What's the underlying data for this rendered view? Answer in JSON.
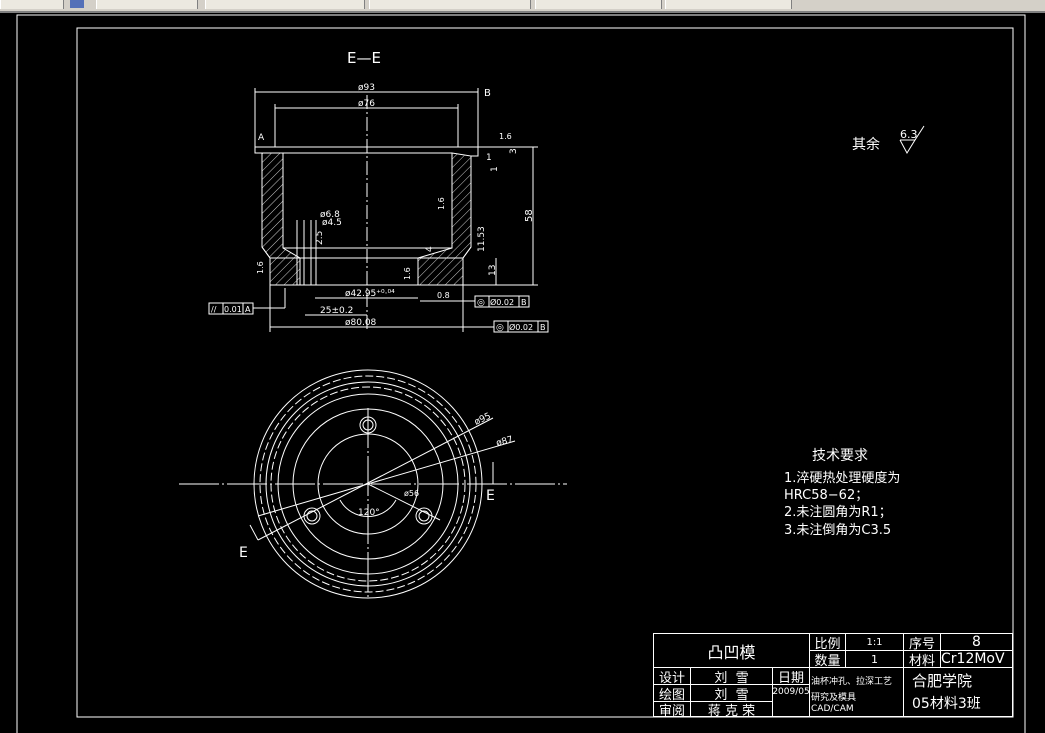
{
  "drawing": {
    "section_label": "E—E",
    "dims": {
      "d93": "ø93",
      "d76": "ø76",
      "d68": "ø6.8",
      "d45": "ø4.5",
      "h25": "2.5",
      "d4295": "ø42.95⁺⁰·⁰⁴",
      "l25": "25±0.2",
      "d8008": "ø80.08",
      "h58": "58",
      "h13": "13",
      "h1153": "11.53",
      "h4": "4",
      "h3": "3",
      "h1a": "1",
      "h1b": "1",
      "r16": "1.6",
      "r08": "0.8",
      "datum_b": "B",
      "datum_a": "A",
      "rough_a": "1.6",
      "rough_b": "1.6",
      "rough_c": "1.6"
    },
    "tolerances": [
      {
        "symbol": "//",
        "value": "0.01",
        "datum": "A"
      },
      {
        "symbol": "◎",
        "value": "Ø0.02",
        "datum": "B"
      },
      {
        "symbol": "◎",
        "value": "Ø0.02",
        "datum": "B"
      }
    ],
    "plan": {
      "d95": "ø95",
      "d87": "ø87",
      "r56": "ø56",
      "angle": "120°",
      "cut_e1": "E",
      "cut_e2": "E"
    },
    "surface_note": {
      "label": "其余",
      "value": "6.3"
    },
    "tech_requirements": {
      "title": "技术要求",
      "lines": [
        "1.淬硬热处理硬度为",
        "HRC58−62；",
        "2.未注圆角为R1；",
        "3.未注倒角为C3.5"
      ]
    }
  },
  "title_block": {
    "part_name": "凸凹模",
    "scale_label": "比例",
    "scale_value": "1:1",
    "qty_label": "数量",
    "qty_value": "1",
    "seq_label": "序号",
    "seq_value": "8",
    "material_label": "材料",
    "material_value": "Cr12MoV",
    "design_label": "设计",
    "design_name": "刘  雪",
    "draw_label": "绘图",
    "draw_name": "刘  雪",
    "review_label": "审阅",
    "review_name": "蒋 克 荣",
    "date_label": "日期",
    "date_value": "2009/05",
    "project": [
      "油杯冲孔、拉深工艺",
      "研究及模具",
      "CAD/CAM"
    ],
    "school": "合肥学院",
    "class": "05材料3班"
  },
  "colors": {
    "background": "#000000",
    "lines": "#ffffff",
    "toolbar": "#d4d0c8"
  }
}
